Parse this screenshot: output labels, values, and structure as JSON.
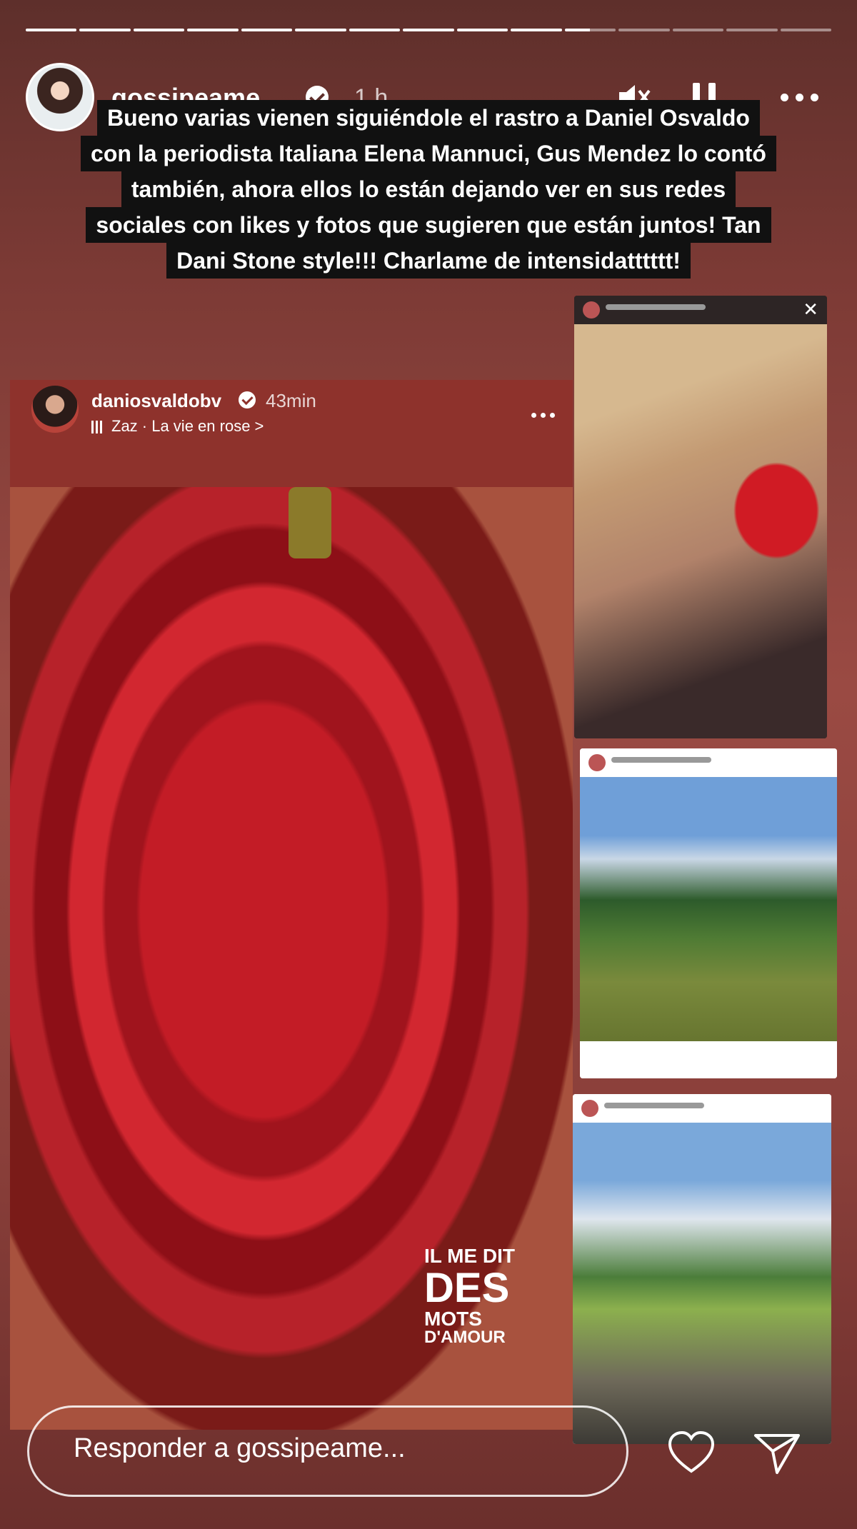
{
  "story": {
    "progress_segments": [
      1,
      1,
      1,
      1,
      1,
      1,
      1,
      1,
      1,
      1,
      0.5,
      0,
      0,
      0,
      0
    ]
  },
  "header": {
    "username": "gossipeame",
    "time": "1 h",
    "icons": [
      "muted-speaker-icon",
      "pause-icon",
      "more-icon"
    ]
  },
  "caption": {
    "lines": [
      "Bueno varias vienen siguiéndole el rastro a Daniel Osvaldo",
      "con la periodista Italiana Elena Mannuci, Gus Mendez lo contó",
      "también, ahora ellos lo están dejando ver en sus redes",
      "sociales con likes y fotos que sugieren que están juntos! Tan",
      "Dani Stone style!!! Charlame de intensidatttttt!"
    ]
  },
  "post": {
    "username": "daniosvaldobv",
    "time": "43min",
    "music": "Zaz · La vie en rose >",
    "quote": {
      "line1": "IL ME DIT",
      "line2": "DES",
      "line3": "MOTS",
      "line4": "D'AMOUR"
    }
  },
  "reply": {
    "placeholder": "Responder a gossipeame..."
  },
  "colors": {
    "background": "#8a3f3a",
    "caption_bg": "#111111",
    "rose": "#c31c26"
  }
}
